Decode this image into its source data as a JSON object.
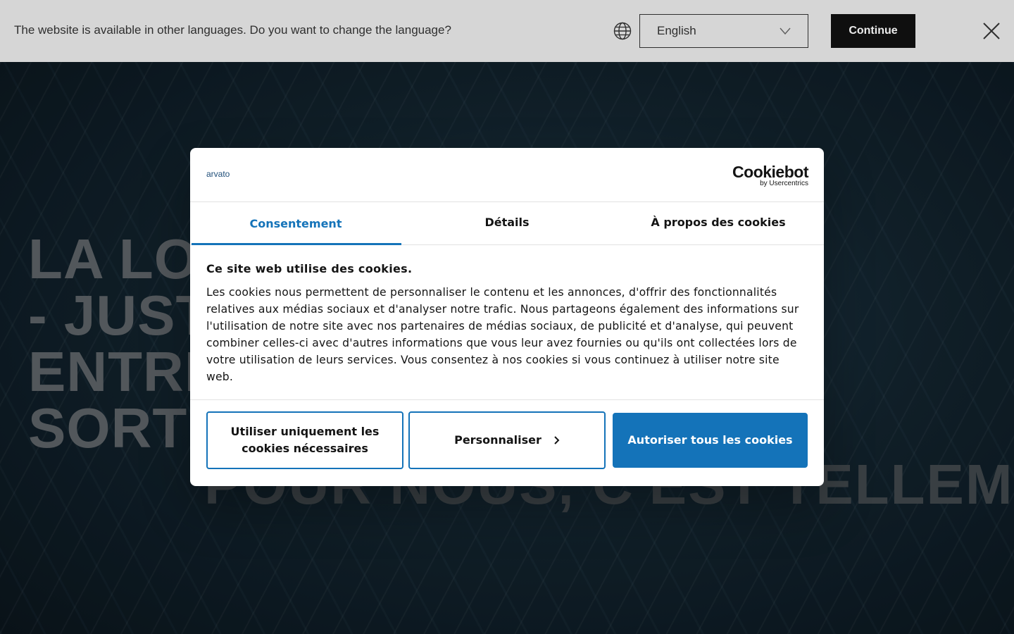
{
  "language_bar": {
    "message": "The website is available in other languages. Do you want to change the language?",
    "selected_language": "English",
    "continue_label": "Continue"
  },
  "hero": {
    "title_visible": "LA LOG                                              LE\n- JUST\nENTRÉ\nSORTIE",
    "subtitle_visible": "POUR NOUS, C'EST TELLEMENT"
  },
  "cookie_dialog": {
    "brand": "arvato",
    "provider_name": "Cookiebot",
    "provider_sub": "by Usercentrics",
    "tabs": [
      {
        "label": "Consentement",
        "active": true
      },
      {
        "label": "Détails",
        "active": false
      },
      {
        "label": "À propos des cookies",
        "active": false
      }
    ],
    "heading": "Ce site web utilise des cookies.",
    "body": "Les cookies nous permettent de personnaliser le contenu et les annonces, d'offrir des fonctionnalités relatives aux médias sociaux et d'analyser notre trafic. Nous partageons également des informations sur l'utilisation de notre site avec nos partenaires de médias sociaux, de publicité et d'analyse, qui peuvent combiner celles-ci avec d'autres informations que vous leur avez fournies ou qu'ils ont collectées lors de votre utilisation de leurs services. Vous consentez à nos cookies si vous continuez à utiliser notre site web.",
    "buttons": {
      "necessary_only": "Utiliser uniquement les cookies nécessaires",
      "customize": "Personnaliser",
      "allow_all": "Autoriser tous les cookies"
    }
  },
  "colors": {
    "accent": "#1473b9",
    "lang_bar_bg": "#e9e9e9",
    "continue_bg": "#111111"
  }
}
